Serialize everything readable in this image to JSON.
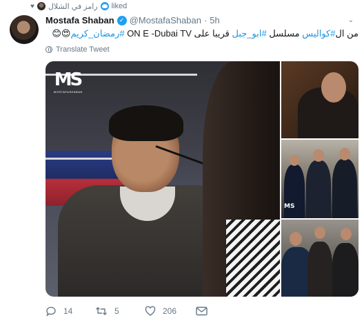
{
  "liked_bar": {
    "liker_name": "رامز في الشلال",
    "liked_label": "liked"
  },
  "tweet": {
    "display_name": "Mostafa Shaban",
    "handle": "@MostafaShaban",
    "separator": "·",
    "time": "5h",
    "text_parts": {
      "p1": "من ال",
      "tag1": "#كواليس",
      "p2": " مسلسل ",
      "tag2": "#ابو_جبل",
      "p3": " قريبا على ON E -Dubai TV ",
      "tag3": "#رمضان_كريم",
      "emoji": "😍😊"
    },
    "translate_label": "Translate Tweet",
    "watermark": "MOSTAFASHABAN"
  },
  "actions": {
    "reply_count": "14",
    "retweet_count": "5",
    "like_count": "206"
  },
  "icons": {
    "liked": "heart-icon",
    "verified": "verified-badge-icon",
    "caret": "chevron-down-icon",
    "translate": "globe-icon",
    "reply": "reply-icon",
    "retweet": "retweet-icon",
    "like": "like-icon",
    "dm": "envelope-icon"
  },
  "colors": {
    "accent": "#1da1f2",
    "hashtag": "#1b95e0",
    "secondary_text": "#657786",
    "primary_text": "#14171a"
  }
}
